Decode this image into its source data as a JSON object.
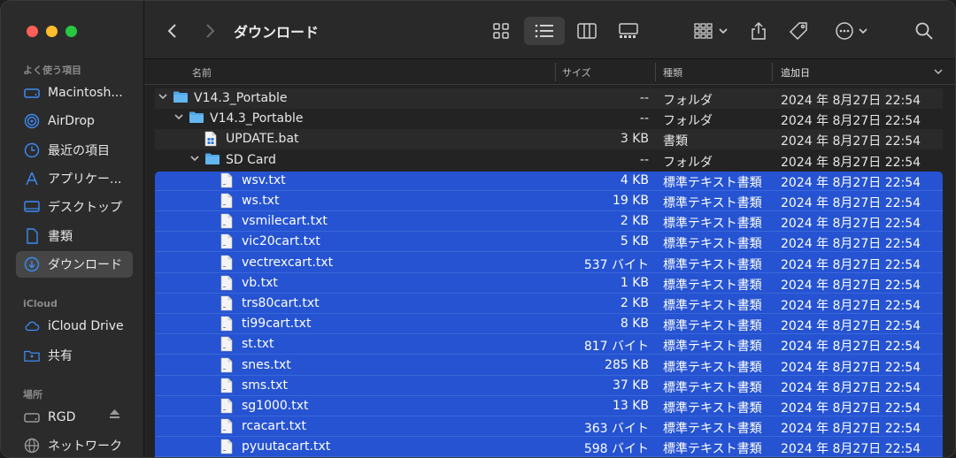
{
  "window": {
    "title": "ダウンロード"
  },
  "sidebar": {
    "favorites_label": "よく使う項目",
    "icloud_label": "iCloud",
    "places_label": "場所",
    "items": [
      {
        "label": "Macintosh...",
        "icon": "hard-drive-icon"
      },
      {
        "label": "AirDrop",
        "icon": "airdrop-icon"
      },
      {
        "label": "最近の項目",
        "icon": "clock-icon"
      },
      {
        "label": "アプリケー...",
        "icon": "applications-icon"
      },
      {
        "label": "デスクトップ",
        "icon": "desktop-icon"
      },
      {
        "label": "書類",
        "icon": "document-icon"
      },
      {
        "label": "ダウンロード",
        "icon": "download-icon"
      },
      {
        "label": "iCloud Drive",
        "icon": "cloud-icon"
      },
      {
        "label": "共有",
        "icon": "shared-folder-icon"
      },
      {
        "label": "RGD",
        "icon": "external-drive-icon"
      },
      {
        "label": "ネットワーク",
        "icon": "network-icon"
      }
    ]
  },
  "columns": {
    "name": "名前",
    "size": "サイズ",
    "kind": "種類",
    "date": "追加日"
  },
  "rows": [
    {
      "name": "V14.3_Portable",
      "size": "--",
      "kind": "フォルダ",
      "date": "2024 年 8月27日 22:54",
      "type": "folder",
      "level": 0,
      "expanded": true
    },
    {
      "name": "V14.3_Portable",
      "size": "--",
      "kind": "フォルダ",
      "date": "2024 年 8月27日 22:54",
      "type": "folder",
      "level": 1,
      "expanded": true
    },
    {
      "name": "UPDATE.bat",
      "size": "3 KB",
      "kind": "書類",
      "date": "2024 年 8月27日 22:54",
      "type": "bat",
      "level": 2
    },
    {
      "name": "SD Card",
      "size": "--",
      "kind": "フォルダ",
      "date": "2024 年 8月27日 22:54",
      "type": "folder",
      "level": 2,
      "expanded": true
    },
    {
      "name": "wsv.txt",
      "size": "4 KB",
      "kind": "標準テキスト書類",
      "date": "2024 年 8月27日 22:54",
      "type": "txt",
      "level": 3,
      "selected": true
    },
    {
      "name": "ws.txt",
      "size": "19 KB",
      "kind": "標準テキスト書類",
      "date": "2024 年 8月27日 22:54",
      "type": "txt",
      "level": 3,
      "selected": true
    },
    {
      "name": "vsmilecart.txt",
      "size": "2 KB",
      "kind": "標準テキスト書類",
      "date": "2024 年 8月27日 22:54",
      "type": "txt",
      "level": 3,
      "selected": true
    },
    {
      "name": "vic20cart.txt",
      "size": "5 KB",
      "kind": "標準テキスト書類",
      "date": "2024 年 8月27日 22:54",
      "type": "txt",
      "level": 3,
      "selected": true
    },
    {
      "name": "vectrexcart.txt",
      "size": "537 バイト",
      "kind": "標準テキスト書類",
      "date": "2024 年 8月27日 22:54",
      "type": "txt",
      "level": 3,
      "selected": true
    },
    {
      "name": "vb.txt",
      "size": "1 KB",
      "kind": "標準テキスト書類",
      "date": "2024 年 8月27日 22:54",
      "type": "txt",
      "level": 3,
      "selected": true
    },
    {
      "name": "trs80cart.txt",
      "size": "2 KB",
      "kind": "標準テキスト書類",
      "date": "2024 年 8月27日 22:54",
      "type": "txt",
      "level": 3,
      "selected": true
    },
    {
      "name": "ti99cart.txt",
      "size": "8 KB",
      "kind": "標準テキスト書類",
      "date": "2024 年 8月27日 22:54",
      "type": "txt",
      "level": 3,
      "selected": true
    },
    {
      "name": "st.txt",
      "size": "817 バイト",
      "kind": "標準テキスト書類",
      "date": "2024 年 8月27日 22:54",
      "type": "txt",
      "level": 3,
      "selected": true
    },
    {
      "name": "snes.txt",
      "size": "285 KB",
      "kind": "標準テキスト書類",
      "date": "2024 年 8月27日 22:54",
      "type": "txt",
      "level": 3,
      "selected": true
    },
    {
      "name": "sms.txt",
      "size": "37 KB",
      "kind": "標準テキスト書類",
      "date": "2024 年 8月27日 22:54",
      "type": "txt",
      "level": 3,
      "selected": true
    },
    {
      "name": "sg1000.txt",
      "size": "13 KB",
      "kind": "標準テキスト書類",
      "date": "2024 年 8月27日 22:54",
      "type": "txt",
      "level": 3,
      "selected": true
    },
    {
      "name": "rcacart.txt",
      "size": "363 バイト",
      "kind": "標準テキスト書類",
      "date": "2024 年 8月27日 22:54",
      "type": "txt",
      "level": 3,
      "selected": true
    },
    {
      "name": "pyuutacart.txt",
      "size": "598 バイト",
      "kind": "標準テキスト書類",
      "date": "2024 年 8月27日 22:54",
      "type": "txt",
      "level": 3,
      "selected": true
    }
  ],
  "colors": {
    "selection": "#2553d1",
    "folder": "#4fa8e8",
    "accent": "#3b8cf5"
  }
}
